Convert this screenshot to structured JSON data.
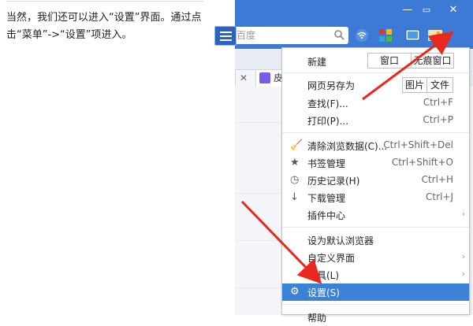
{
  "article": {
    "text": "当然，我们还可以进入“设置”界面。通过点击“菜单”->“设置”项进入。"
  },
  "window": {
    "minimize": "—",
    "restore": "▭",
    "close": "✕"
  },
  "toolbar": {
    "address_partial": "百度"
  },
  "tabs": [
    {
      "label": "皮"
    }
  ],
  "menu": {
    "new_label": "新建",
    "new_window": "窗口",
    "new_private": "无痕窗口",
    "save_as_label": "网页另存为",
    "save_image": "图片",
    "save_file": "文件",
    "items": [
      {
        "label": "查找(F)...",
        "shortcut": "Ctrl+F"
      },
      {
        "label": "打印(P)...",
        "shortcut": "Ctrl+P"
      },
      {
        "label": "清除浏览数据(C)...",
        "shortcut": "Ctrl+Shift+Del"
      },
      {
        "label": "书签管理",
        "shortcut": "Ctrl+Shift+O"
      },
      {
        "label": "历史记录(H)",
        "shortcut": "Ctrl+H"
      },
      {
        "label": "下载管理",
        "shortcut": "Ctrl+J"
      },
      {
        "label": "插件中心",
        "shortcut": ""
      },
      {
        "label": "设为默认浏览器",
        "shortcut": ""
      },
      {
        "label": "自定义界面",
        "shortcut": ""
      },
      {
        "label": "工具(L)",
        "shortcut": ""
      },
      {
        "label": "设置(S)",
        "shortcut": ""
      },
      {
        "label": "帮助",
        "shortcut": ""
      }
    ],
    "submenu_arrow": "›"
  },
  "colors": {
    "accent": "#3d7ad6",
    "selected": "#3b82d6",
    "arrow": "#e8271d"
  }
}
